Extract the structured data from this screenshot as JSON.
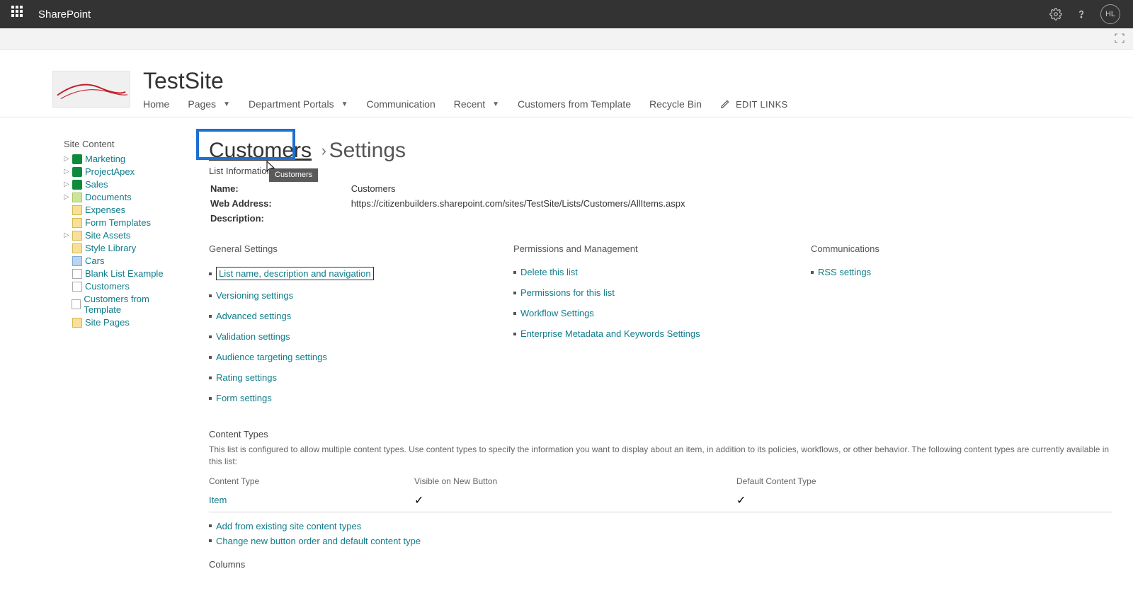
{
  "suite": {
    "product": "SharePoint",
    "avatar": "HL"
  },
  "site": {
    "title": "TestSite",
    "nav": {
      "home": "Home",
      "pages": "Pages",
      "dept": "Department Portals",
      "comm": "Communication",
      "recent": "Recent",
      "custTemplate": "Customers from Template",
      "recycle": "Recycle Bin",
      "editLinks": "EDIT LINKS"
    }
  },
  "tree": {
    "header": "Site Content",
    "items": [
      {
        "label": "Marketing",
        "icon": "site",
        "expandable": true
      },
      {
        "label": "ProjectApex",
        "icon": "site",
        "expandable": true
      },
      {
        "label": "Sales",
        "icon": "site",
        "expandable": true
      },
      {
        "label": "Documents",
        "icon": "lib",
        "expandable": true
      },
      {
        "label": "Expenses",
        "icon": "folder",
        "expandable": false
      },
      {
        "label": "Form Templates",
        "icon": "folder",
        "expandable": false
      },
      {
        "label": "Site Assets",
        "icon": "folder",
        "expandable": true
      },
      {
        "label": "Style Library",
        "icon": "folder",
        "expandable": false
      },
      {
        "label": "Cars",
        "icon": "pic",
        "expandable": false
      },
      {
        "label": "Blank List Example",
        "icon": "list",
        "expandable": false
      },
      {
        "label": "Customers",
        "icon": "list",
        "expandable": false
      },
      {
        "label": "Customers from Template",
        "icon": "list",
        "expandable": false
      },
      {
        "label": "Site Pages",
        "icon": "folder",
        "expandable": false
      }
    ]
  },
  "page": {
    "linkTitle": "Customers",
    "staticTitle": "Settings",
    "tooltip": "Customers",
    "listInfoHeading": "List Information",
    "info": {
      "nameLabel": "Name:",
      "nameValue": "Customers",
      "webLabel": "Web Address:",
      "webValue": "https://citizenbuilders.sharepoint.com/sites/TestSite/Lists/Customers/AllItems.aspx",
      "descLabel": "Description:"
    },
    "cols": {
      "general": {
        "heading": "General Settings",
        "links": [
          "List name, description and navigation",
          "Versioning settings",
          "Advanced settings",
          "Validation settings",
          "Audience targeting settings",
          "Rating settings",
          "Form settings"
        ]
      },
      "perm": {
        "heading": "Permissions and Management",
        "links": [
          "Delete this list",
          "Permissions for this list",
          "Workflow Settings",
          "Enterprise Metadata and Keywords Settings"
        ]
      },
      "comm": {
        "heading": "Communications",
        "links": [
          "RSS settings"
        ]
      }
    },
    "ctypes": {
      "heading": "Content Types",
      "desc": "This list is configured to allow multiple content types. Use content types to specify the information you want to display about an item, in addition to its policies, workflows, or other behavior. The following content types are currently available in this list:",
      "tableHead": {
        "ct": "Content Type",
        "vis": "Visible on New Button",
        "def": "Default Content Type"
      },
      "rows": [
        {
          "name": "Item",
          "visible": true,
          "default": true
        }
      ],
      "footerLinks": [
        "Add from existing site content types",
        "Change new button order and default content type"
      ]
    },
    "columnsHeading": "Columns"
  }
}
